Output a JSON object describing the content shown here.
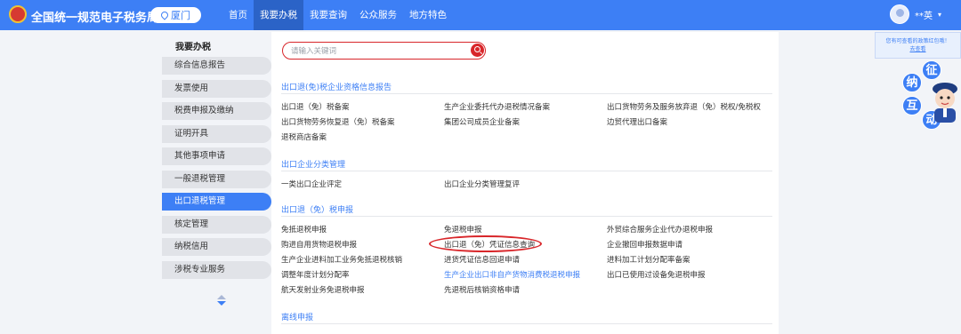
{
  "header": {
    "site_title": "全国统一规范电子税务局",
    "city": "厦门",
    "nav": [
      "首页",
      "我要办税",
      "我要查询",
      "公众服务",
      "地方特色"
    ],
    "active_nav": 1,
    "user_name": "**英",
    "brand_color": "#3d7ff5"
  },
  "sidebar": {
    "heading": "我要办税",
    "items": [
      "综合信息报告",
      "发票使用",
      "税费申报及缴纳",
      "证明开具",
      "其他事项申请",
      "一般退税管理",
      "出口退税管理",
      "核定管理",
      "纳税信用",
      "涉税专业服务"
    ],
    "active_index": 6
  },
  "search": {
    "placeholder": "请输入关键词"
  },
  "sections": [
    {
      "title": "出口退(免)税企业资格信息报告",
      "rows": [
        [
          "出口退（免）税备案",
          "生产企业委托代办退税情况备案",
          "出口货物劳务及服务放弃退（免）税权/免税权"
        ],
        [
          "出口货物劳务恢复退（免）税备案",
          "集团公司成员企业备案",
          "边贸代理出口备案"
        ],
        [
          "退税商店备案",
          "",
          ""
        ]
      ]
    },
    {
      "title": "出口企业分类管理",
      "rows": [
        [
          "一类出口企业评定",
          "出口企业分类管理复评",
          ""
        ]
      ]
    },
    {
      "title": "出口退（免）税申报",
      "rows": [
        [
          "免抵退税申报",
          "免退税申报",
          "外贸综合服务企业代办退税申报"
        ],
        [
          "购进自用货物退税申报",
          "出口退（免）凭证信息查询",
          "企业撤回申报数据申请"
        ],
        [
          "生产企业进料加工业务免抵退税核销",
          "进货凭证信息回退申请",
          "进料加工计划分配率备案"
        ],
        [
          "调整年度计划分配率",
          "生产企业出口非自产货物消费税退税申报",
          "出口已使用过设备免退税申报"
        ],
        [
          "航天发射业务免退税申报",
          "先退税后核销资格申请",
          ""
        ]
      ]
    },
    {
      "title": "离线申报",
      "rows": []
    }
  ],
  "highlighted_link": "出口退（免）凭证信息查询",
  "promo": {
    "text": "您有可查看的政策红包哦！",
    "link": "去查看"
  },
  "mascot": {
    "chars": [
      "征",
      "纳",
      "互",
      "动"
    ]
  }
}
